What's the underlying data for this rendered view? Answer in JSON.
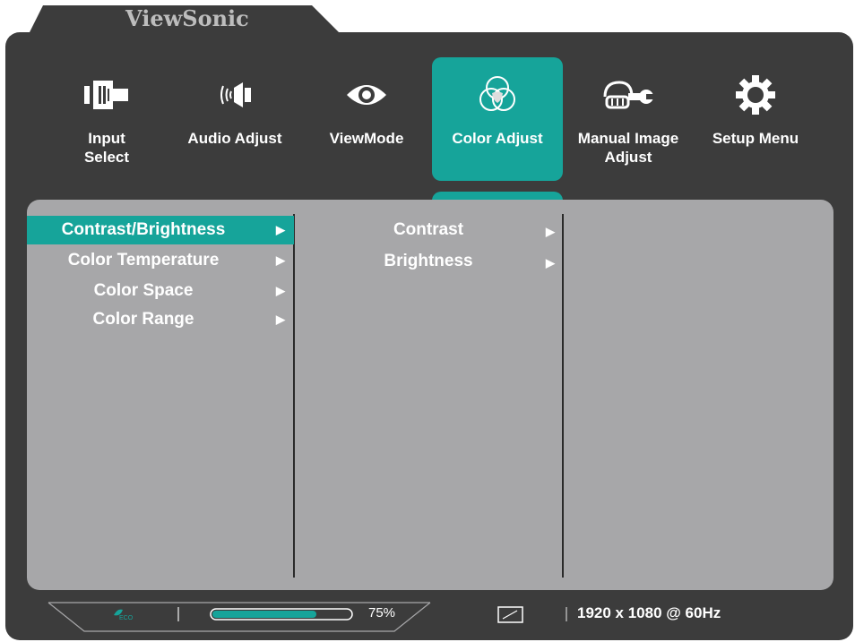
{
  "brand": "ViewSonic",
  "top_menu": [
    {
      "label": "Input\nSelect",
      "icon": "input-select-icon",
      "active": false
    },
    {
      "label": "Audio Adjust",
      "icon": "speaker-icon",
      "active": false
    },
    {
      "label": "ViewMode",
      "icon": "eye-icon",
      "active": false
    },
    {
      "label": "Color Adjust",
      "icon": "color-circles-icon",
      "active": true
    },
    {
      "label": "Manual Image\nAdjust",
      "icon": "hand-wrench-icon",
      "active": false
    },
    {
      "label": "Setup Menu",
      "icon": "gear-icon",
      "active": false
    }
  ],
  "left_menu": [
    {
      "label": "Contrast/Brightness",
      "selected": true
    },
    {
      "label": "Color Temperature",
      "selected": false
    },
    {
      "label": "Color Space",
      "selected": false
    },
    {
      "label": "Color Range",
      "selected": false
    }
  ],
  "sub_menu": [
    {
      "label": "Contrast"
    },
    {
      "label": "Brightness"
    }
  ],
  "status": {
    "eco_label": "ECO",
    "progress_value": 0.75,
    "progress_label": "75%",
    "resolution": "1920 x 1080 @ 60Hz"
  },
  "colors": {
    "frame": "#3c3c3c",
    "panel": "#a7a7a9",
    "accent": "#16a49a"
  }
}
